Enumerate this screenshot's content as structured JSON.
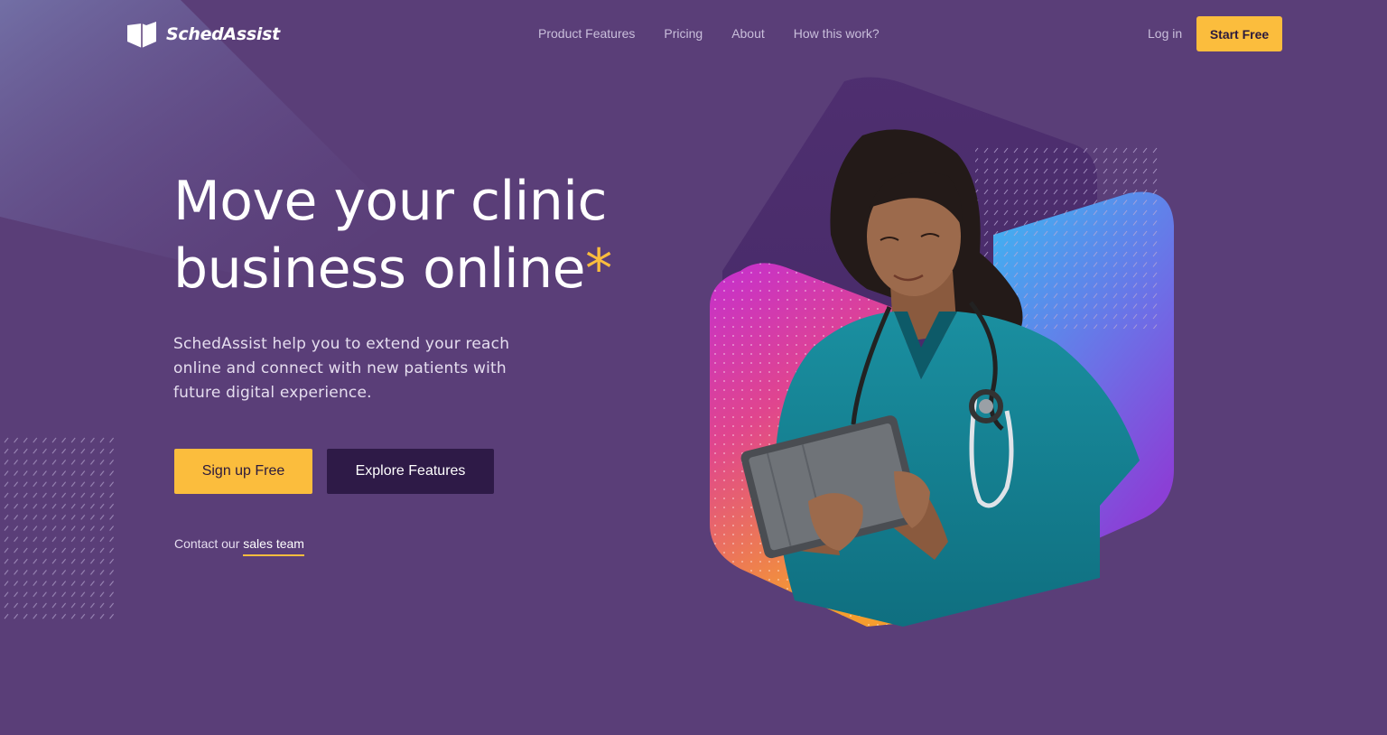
{
  "brand": {
    "name": "SchedAssist",
    "logo_icon": "shield-book-icon"
  },
  "nav": {
    "links": [
      "Product Features",
      "Pricing",
      "About",
      "How this work?"
    ],
    "login": "Log in",
    "cta": "Start Free"
  },
  "hero": {
    "headline_line1": "Move your clinic",
    "headline_line2": "business online",
    "headline_mark": "*",
    "subtext_line1": "SchedAssist help you to extend your reach",
    "subtext_line2": "online and connect with new patients with",
    "subtext_line3": "future digital experience.",
    "primary_button": "Sign up Free",
    "secondary_button": "Explore Features",
    "contact_prefix": "Contact our ",
    "contact_link": "sales team",
    "image_subject": "nurse-with-tablet-illustration"
  },
  "colors": {
    "background": "#5a3e78",
    "accent": "#fbbd3d",
    "dark_button": "#2e1a47",
    "nav_text": "#c9bedb"
  }
}
